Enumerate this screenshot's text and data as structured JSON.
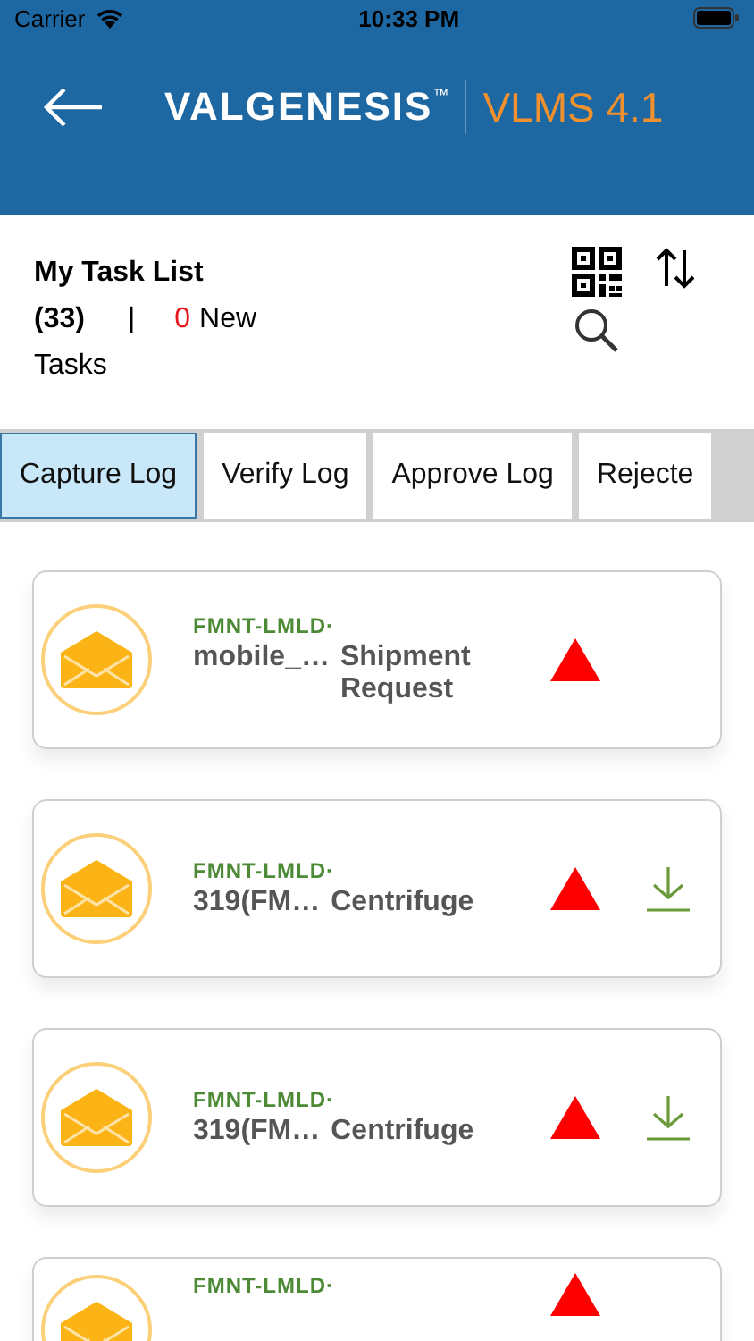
{
  "status_bar": {
    "carrier": "Carrier",
    "time": "10:33 PM"
  },
  "header": {
    "logo": "VALGENESIS",
    "trademark": "™",
    "app_version": "VLMS 4.1"
  },
  "task_list": {
    "title": "My Task List",
    "count": "(33)",
    "separator": "|",
    "new_count": "0",
    "new_label": "New",
    "tasks_label": "Tasks"
  },
  "tabs": [
    {
      "label": "Capture Log",
      "selected": true
    },
    {
      "label": "Verify Log",
      "selected": false
    },
    {
      "label": "Approve Log",
      "selected": false
    },
    {
      "label": "Rejecte",
      "selected": false
    }
  ],
  "tasks": [
    {
      "code": "FMNT-LMLD·",
      "name": "mobile_…",
      "title": "Shipment Request",
      "high_priority": true,
      "downloadable": false
    },
    {
      "code": "FMNT-LMLD·",
      "name": "319(FM…",
      "title": "Centrifuge",
      "high_priority": true,
      "downloadable": true
    },
    {
      "code": "FMNT-LMLD·",
      "name": "319(FM…",
      "title": "Centrifuge",
      "high_priority": true,
      "downloadable": true
    },
    {
      "code": "FMNT-LMLD·",
      "high_priority": true,
      "downloadable": false
    }
  ]
}
